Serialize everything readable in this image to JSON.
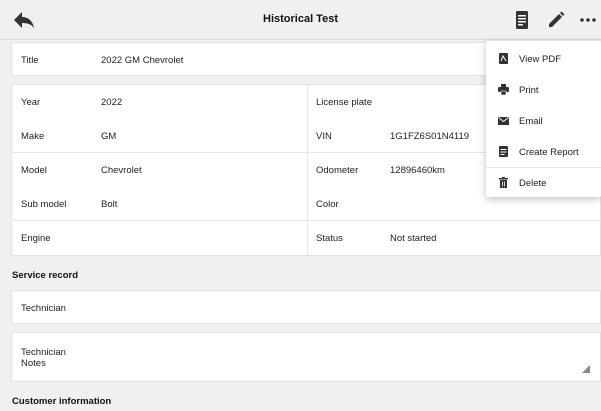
{
  "header": {
    "title": "Historical Test",
    "back_icon": "arrow-back-icon",
    "report_icon": "report-icon",
    "edit_icon": "pencil-icon",
    "more_icon": "more-horizontal-icon"
  },
  "title_field": {
    "label": "Title",
    "value": "2022 GM Chevrolet"
  },
  "vehicle": {
    "left": [
      {
        "label": "Year",
        "value": "2022"
      },
      {
        "label": "Make",
        "value": "GM"
      },
      {
        "label": "Model",
        "value": "Chevrolet"
      },
      {
        "label": "Sub model",
        "value": "Bolt"
      },
      {
        "label": "Engine",
        "value": ""
      }
    ],
    "right": [
      {
        "label": "License plate",
        "value": ""
      },
      {
        "label": "VIN",
        "value": "1G1FZ6S01N4119"
      },
      {
        "label": "Odometer",
        "value": "12896460km"
      },
      {
        "label": "Color",
        "value": ""
      },
      {
        "label": "Status",
        "value": "Not started"
      }
    ]
  },
  "service_record": {
    "title": "Service record",
    "technician_label": "Technician",
    "notes_label_line1": "Technician",
    "notes_label_line2": "Notes"
  },
  "customer_info": {
    "title": "Customer information"
  },
  "menu": {
    "items": [
      {
        "label": "View PDF",
        "icon": "pdf-icon"
      },
      {
        "label": "Print",
        "icon": "printer-icon"
      },
      {
        "label": "Email",
        "icon": "email-icon"
      },
      {
        "label": "Create Report",
        "icon": "report-icon"
      },
      {
        "label": "Delete",
        "icon": "trash-icon"
      }
    ]
  },
  "colors": {
    "background": "#f0f0f0",
    "card": "#ffffff",
    "text": "#222222"
  }
}
